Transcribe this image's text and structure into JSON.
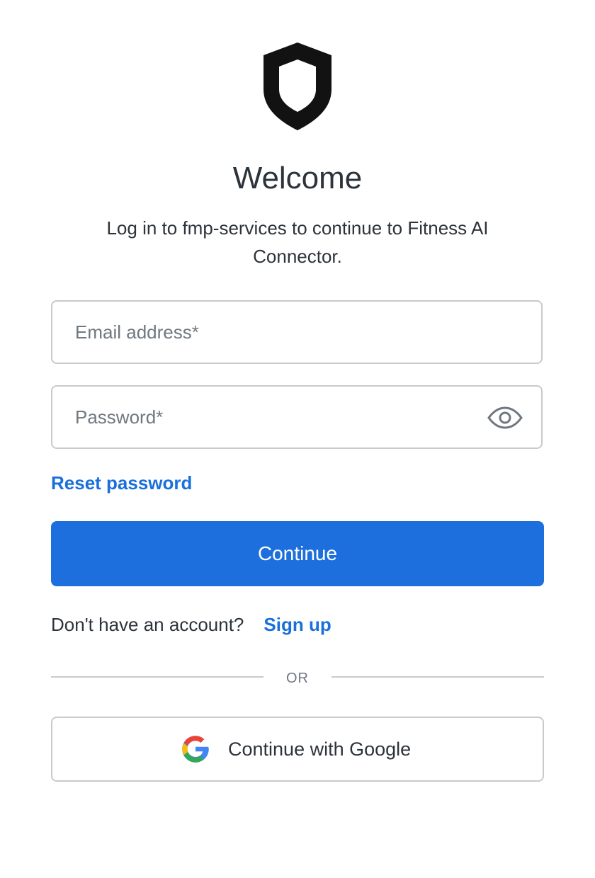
{
  "header": {
    "logo_icon": "shield-icon",
    "title": "Welcome",
    "subtitle": "Log in to fmp-services to continue to Fitness AI Connector."
  },
  "form": {
    "email": {
      "placeholder": "Email address*",
      "value": ""
    },
    "password": {
      "placeholder": "Password*",
      "value": "",
      "toggle_icon": "eye-icon"
    },
    "reset_password_label": "Reset password",
    "continue_label": "Continue"
  },
  "signup": {
    "prompt": "Don't have an account?",
    "link_label": "Sign up"
  },
  "divider": {
    "label": "OR"
  },
  "social": {
    "google_label": "Continue with Google",
    "google_icon": "google-icon"
  },
  "colors": {
    "primary": "#1c6fdc",
    "link": "#1a6fdc",
    "text": "#2d333a",
    "muted": "#6f7780",
    "border": "#c9cace"
  }
}
